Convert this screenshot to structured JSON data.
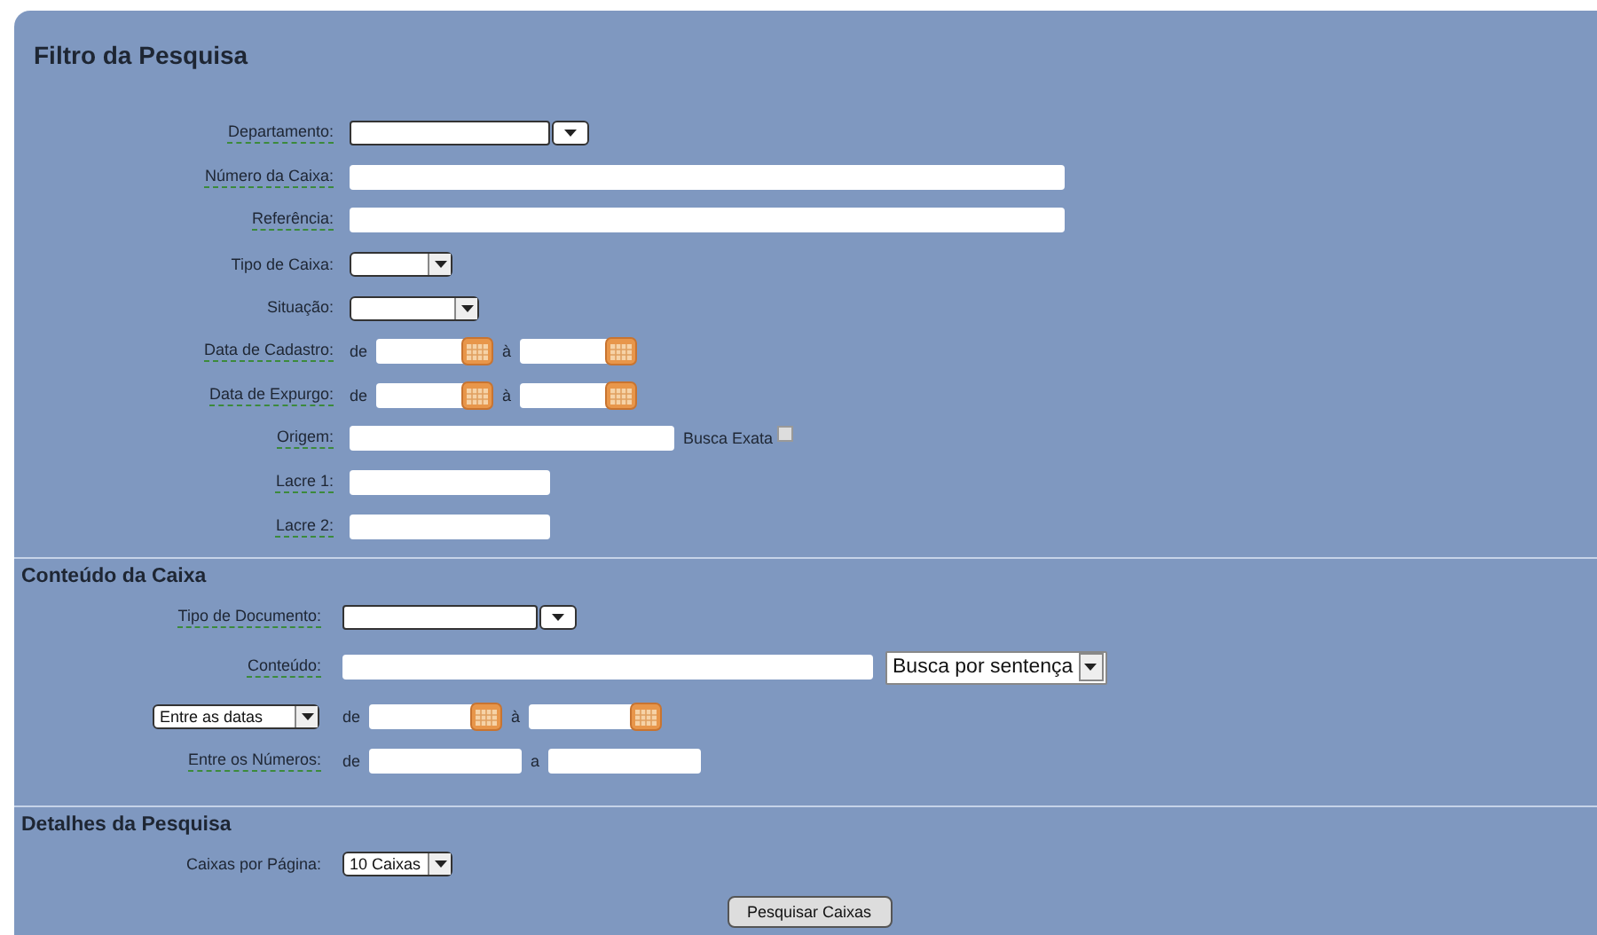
{
  "title": "Filtro da Pesquisa",
  "sections": [
    {
      "rows": [
        {
          "label": "Departamento:",
          "hint": true,
          "controls": [
            {
              "kind": "combo"
            }
          ]
        },
        {
          "label": "Número da Caixa:",
          "hint": true,
          "controls": [
            {
              "kind": "text"
            }
          ]
        },
        {
          "label": "Referência:",
          "hint": true,
          "controls": [
            {
              "kind": "text"
            }
          ]
        },
        {
          "label": "Tipo de Caixa:",
          "hint": false,
          "controls": [
            {
              "kind": "select"
            }
          ]
        },
        {
          "label": "Situação:",
          "hint": false,
          "controls": [
            {
              "kind": "select"
            }
          ]
        },
        {
          "label": "Data de Cadastro:",
          "hint": true,
          "controls": [
            {
              "kind": "word",
              "text": "de"
            },
            {
              "kind": "date"
            },
            {
              "kind": "word",
              "text": "à"
            },
            {
              "kind": "date"
            }
          ]
        },
        {
          "label": "Data de Expurgo:",
          "hint": true,
          "controls": [
            {
              "kind": "word",
              "text": "de"
            },
            {
              "kind": "date"
            },
            {
              "kind": "word",
              "text": "à"
            },
            {
              "kind": "date"
            }
          ]
        },
        {
          "label": "Origem:",
          "hint": true,
          "controls": [
            {
              "kind": "text"
            },
            {
              "kind": "word",
              "text": "Busca Exata"
            },
            {
              "kind": "checkbox",
              "checked": false
            }
          ]
        },
        {
          "label": "Lacre 1:",
          "hint": true,
          "controls": [
            {
              "kind": "text"
            }
          ]
        },
        {
          "label": "Lacre 2:",
          "hint": true,
          "controls": [
            {
              "kind": "text"
            }
          ]
        }
      ]
    },
    {
      "title": "Conteúdo da Caixa",
      "rows": [
        {
          "label": "Tipo de Documento:",
          "hint": true,
          "controls": [
            {
              "kind": "combo"
            }
          ]
        },
        {
          "label": "Conteúdo:",
          "hint": true,
          "controls": [
            {
              "kind": "text"
            },
            {
              "kind": "select",
              "value": "Busca por sentença"
            }
          ]
        },
        {
          "label_select": "Entre as datas",
          "controls": [
            {
              "kind": "word",
              "text": "de"
            },
            {
              "kind": "date"
            },
            {
              "kind": "word",
              "text": "à"
            },
            {
              "kind": "date"
            }
          ]
        },
        {
          "label": "Entre os Números:",
          "hint": true,
          "controls": [
            {
              "kind": "word",
              "text": "de"
            },
            {
              "kind": "text"
            },
            {
              "kind": "word",
              "text": "a"
            },
            {
              "kind": "text"
            }
          ]
        }
      ]
    },
    {
      "title": "Detalhes da Pesquisa",
      "rows": [
        {
          "label": "Caixas por Página:",
          "hint": false,
          "controls": [
            {
              "kind": "select",
              "value": "10 Caixas"
            }
          ]
        }
      ]
    }
  ],
  "button": "Pesquisar Caixas"
}
